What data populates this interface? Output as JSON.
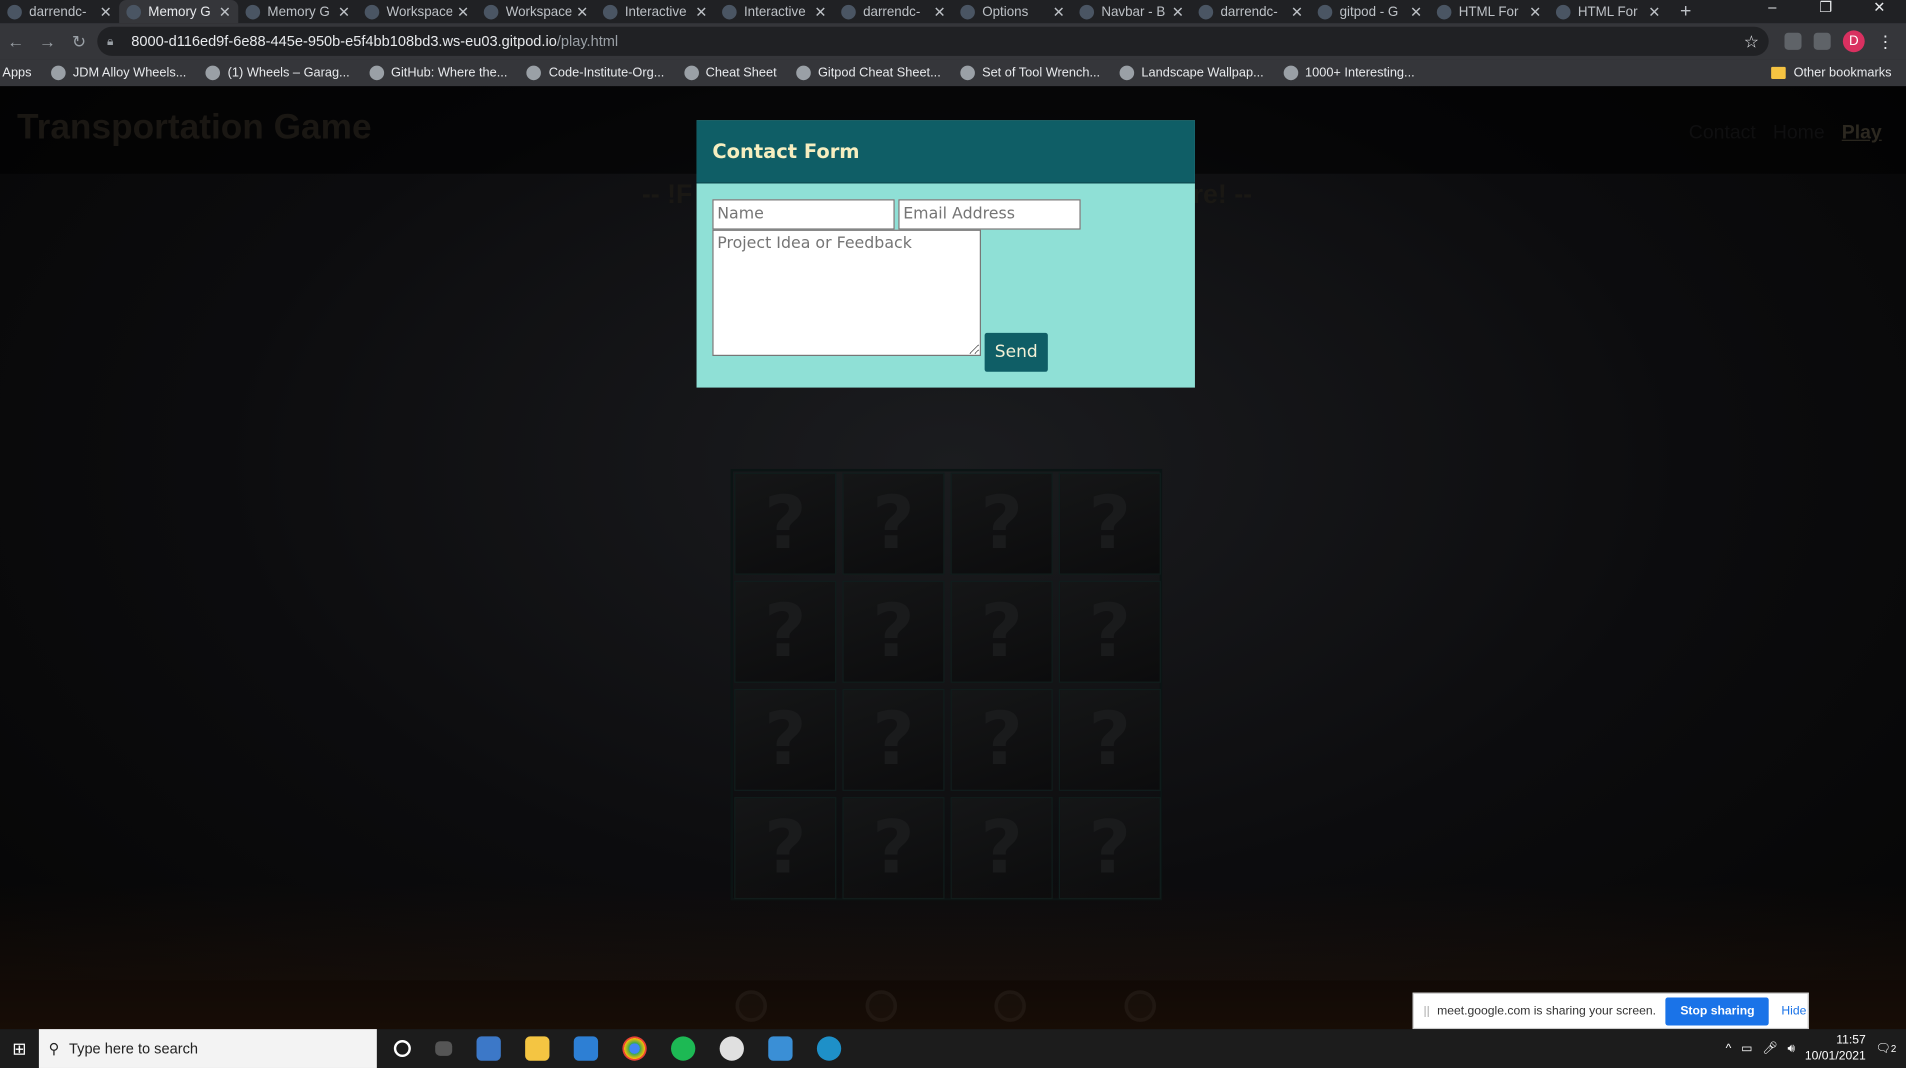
{
  "browser": {
    "tabs": [
      {
        "label": "darrendc-",
        "active": false
      },
      {
        "label": "Memory G",
        "active": true
      },
      {
        "label": "Memory G",
        "active": false
      },
      {
        "label": "Workspace",
        "active": false
      },
      {
        "label": "Workspace",
        "active": false
      },
      {
        "label": "Interactive",
        "active": false
      },
      {
        "label": "Interactive",
        "active": false
      },
      {
        "label": "darrendc-",
        "active": false
      },
      {
        "label": "Options",
        "active": false
      },
      {
        "label": "Navbar - B",
        "active": false
      },
      {
        "label": "darrendc-",
        "active": false
      },
      {
        "label": "gitpod - G",
        "active": false
      },
      {
        "label": "HTML For",
        "active": false
      },
      {
        "label": "HTML For",
        "active": false
      }
    ],
    "url_host": "8000-d116ed9f-6e88-445e-950b-e5f4bb108bd3.ws-eu03.gitpod.io",
    "url_path": "/play.html",
    "avatar_letter": "D",
    "bookmarks": [
      "Apps",
      "JDM Alloy Wheels...",
      "(1) Wheels – Garag...",
      "GitHub: Where the...",
      "Code-Institute-Org...",
      "Cheat Sheet",
      "Gitpod Cheat Sheet...",
      "Set of Tool Wrench...",
      "Landscape Wallpap...",
      "1000+ Interesting..."
    ],
    "other_bookmarks": "Other bookmarks"
  },
  "site": {
    "title": "Transportation Game",
    "nav": [
      {
        "label": "Contact",
        "active": false
      },
      {
        "label": "Home",
        "active": false
      },
      {
        "label": "Play",
        "active": true
      }
    ],
    "banner_left": "-- !F",
    "banner_right": "re! --",
    "card_symbol": "?",
    "card_count": 16
  },
  "modal": {
    "title": "Contact Form",
    "name_placeholder": "Name",
    "email_placeholder": "Email Address",
    "message_placeholder": "Project Idea or Feedback",
    "send_label": "Send"
  },
  "screen_share": {
    "message": "meet.google.com is sharing your screen.",
    "stop_label": "Stop sharing",
    "hide_label": "Hide"
  },
  "taskbar": {
    "search_placeholder": "Type here to search",
    "time": "11:57",
    "date": "10/01/2021",
    "notification_count": "2"
  },
  "colors": {
    "modal_header": "#0f5e66",
    "modal_body": "#8fe0d6",
    "modal_title_text": "#f6eec0"
  }
}
